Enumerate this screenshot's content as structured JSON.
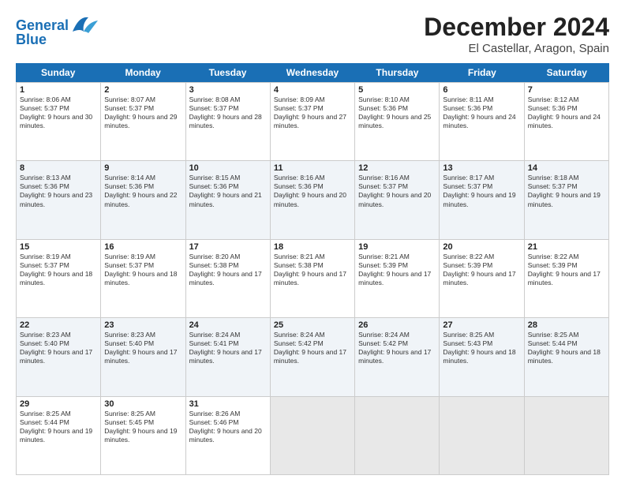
{
  "header": {
    "logo_line1": "General",
    "logo_line2": "Blue",
    "main_title": "December 2024",
    "subtitle": "El Castellar, Aragon, Spain"
  },
  "calendar": {
    "days": [
      "Sunday",
      "Monday",
      "Tuesday",
      "Wednesday",
      "Thursday",
      "Friday",
      "Saturday"
    ],
    "rows": [
      [
        {
          "day": "1",
          "sunrise": "Sunrise: 8:06 AM",
          "sunset": "Sunset: 5:37 PM",
          "daylight": "Daylight: 9 hours and 30 minutes."
        },
        {
          "day": "2",
          "sunrise": "Sunrise: 8:07 AM",
          "sunset": "Sunset: 5:37 PM",
          "daylight": "Daylight: 9 hours and 29 minutes."
        },
        {
          "day": "3",
          "sunrise": "Sunrise: 8:08 AM",
          "sunset": "Sunset: 5:37 PM",
          "daylight": "Daylight: 9 hours and 28 minutes."
        },
        {
          "day": "4",
          "sunrise": "Sunrise: 8:09 AM",
          "sunset": "Sunset: 5:37 PM",
          "daylight": "Daylight: 9 hours and 27 minutes."
        },
        {
          "day": "5",
          "sunrise": "Sunrise: 8:10 AM",
          "sunset": "Sunset: 5:36 PM",
          "daylight": "Daylight: 9 hours and 25 minutes."
        },
        {
          "day": "6",
          "sunrise": "Sunrise: 8:11 AM",
          "sunset": "Sunset: 5:36 PM",
          "daylight": "Daylight: 9 hours and 24 minutes."
        },
        {
          "day": "7",
          "sunrise": "Sunrise: 8:12 AM",
          "sunset": "Sunset: 5:36 PM",
          "daylight": "Daylight: 9 hours and 24 minutes."
        }
      ],
      [
        {
          "day": "8",
          "sunrise": "Sunrise: 8:13 AM",
          "sunset": "Sunset: 5:36 PM",
          "daylight": "Daylight: 9 hours and 23 minutes."
        },
        {
          "day": "9",
          "sunrise": "Sunrise: 8:14 AM",
          "sunset": "Sunset: 5:36 PM",
          "daylight": "Daylight: 9 hours and 22 minutes."
        },
        {
          "day": "10",
          "sunrise": "Sunrise: 8:15 AM",
          "sunset": "Sunset: 5:36 PM",
          "daylight": "Daylight: 9 hours and 21 minutes."
        },
        {
          "day": "11",
          "sunrise": "Sunrise: 8:16 AM",
          "sunset": "Sunset: 5:36 PM",
          "daylight": "Daylight: 9 hours and 20 minutes."
        },
        {
          "day": "12",
          "sunrise": "Sunrise: 8:16 AM",
          "sunset": "Sunset: 5:37 PM",
          "daylight": "Daylight: 9 hours and 20 minutes."
        },
        {
          "day": "13",
          "sunrise": "Sunrise: 8:17 AM",
          "sunset": "Sunset: 5:37 PM",
          "daylight": "Daylight: 9 hours and 19 minutes."
        },
        {
          "day": "14",
          "sunrise": "Sunrise: 8:18 AM",
          "sunset": "Sunset: 5:37 PM",
          "daylight": "Daylight: 9 hours and 19 minutes."
        }
      ],
      [
        {
          "day": "15",
          "sunrise": "Sunrise: 8:19 AM",
          "sunset": "Sunset: 5:37 PM",
          "daylight": "Daylight: 9 hours and 18 minutes."
        },
        {
          "day": "16",
          "sunrise": "Sunrise: 8:19 AM",
          "sunset": "Sunset: 5:37 PM",
          "daylight": "Daylight: 9 hours and 18 minutes."
        },
        {
          "day": "17",
          "sunrise": "Sunrise: 8:20 AM",
          "sunset": "Sunset: 5:38 PM",
          "daylight": "Daylight: 9 hours and 17 minutes."
        },
        {
          "day": "18",
          "sunrise": "Sunrise: 8:21 AM",
          "sunset": "Sunset: 5:38 PM",
          "daylight": "Daylight: 9 hours and 17 minutes."
        },
        {
          "day": "19",
          "sunrise": "Sunrise: 8:21 AM",
          "sunset": "Sunset: 5:39 PM",
          "daylight": "Daylight: 9 hours and 17 minutes."
        },
        {
          "day": "20",
          "sunrise": "Sunrise: 8:22 AM",
          "sunset": "Sunset: 5:39 PM",
          "daylight": "Daylight: 9 hours and 17 minutes."
        },
        {
          "day": "21",
          "sunrise": "Sunrise: 8:22 AM",
          "sunset": "Sunset: 5:39 PM",
          "daylight": "Daylight: 9 hours and 17 minutes."
        }
      ],
      [
        {
          "day": "22",
          "sunrise": "Sunrise: 8:23 AM",
          "sunset": "Sunset: 5:40 PM",
          "daylight": "Daylight: 9 hours and 17 minutes."
        },
        {
          "day": "23",
          "sunrise": "Sunrise: 8:23 AM",
          "sunset": "Sunset: 5:40 PM",
          "daylight": "Daylight: 9 hours and 17 minutes."
        },
        {
          "day": "24",
          "sunrise": "Sunrise: 8:24 AM",
          "sunset": "Sunset: 5:41 PM",
          "daylight": "Daylight: 9 hours and 17 minutes."
        },
        {
          "day": "25",
          "sunrise": "Sunrise: 8:24 AM",
          "sunset": "Sunset: 5:42 PM",
          "daylight": "Daylight: 9 hours and 17 minutes."
        },
        {
          "day": "26",
          "sunrise": "Sunrise: 8:24 AM",
          "sunset": "Sunset: 5:42 PM",
          "daylight": "Daylight: 9 hours and 17 minutes."
        },
        {
          "day": "27",
          "sunrise": "Sunrise: 8:25 AM",
          "sunset": "Sunset: 5:43 PM",
          "daylight": "Daylight: 9 hours and 18 minutes."
        },
        {
          "day": "28",
          "sunrise": "Sunrise: 8:25 AM",
          "sunset": "Sunset: 5:44 PM",
          "daylight": "Daylight: 9 hours and 18 minutes."
        }
      ],
      [
        {
          "day": "29",
          "sunrise": "Sunrise: 8:25 AM",
          "sunset": "Sunset: 5:44 PM",
          "daylight": "Daylight: 9 hours and 19 minutes."
        },
        {
          "day": "30",
          "sunrise": "Sunrise: 8:25 AM",
          "sunset": "Sunset: 5:45 PM",
          "daylight": "Daylight: 9 hours and 19 minutes."
        },
        {
          "day": "31",
          "sunrise": "Sunrise: 8:26 AM",
          "sunset": "Sunset: 5:46 PM",
          "daylight": "Daylight: 9 hours and 20 minutes."
        },
        null,
        null,
        null,
        null
      ]
    ]
  }
}
